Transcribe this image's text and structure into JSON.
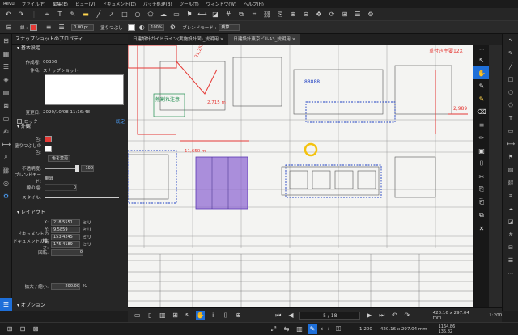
{
  "menu": {
    "items": [
      "Revu",
      "ファイル(F)",
      "編集(E)",
      "ビュー(V)",
      "ドキュメント(D)",
      "バッチ処理(B)",
      "ツール(T)",
      "ウィンドウ(W)",
      "ヘルプ(H)"
    ]
  },
  "toolbar2": {
    "fill_label": "線 :",
    "line_width": "0.00 pt",
    "opacity_label": "塗りつぶし :",
    "opacity_value": "100%",
    "blend_label": "ブレンドモード :",
    "blend_value": "乗算"
  },
  "panel": {
    "title": "スナップショットのプロパティ",
    "basic_section": "基本設定",
    "author_label": "作成者:",
    "author_value": "00336",
    "subject_label": "件名:",
    "subject_value": "スナップショット",
    "modified_label": "変更日:",
    "modified_value": "2020/10/08 11:16:48",
    "lock_label": "ロック",
    "reset_link": "既定",
    "appearance_section": "外観",
    "color_label": "色:",
    "fill_label": "塗りつぶしの色:",
    "color_change_button": "色を変更",
    "opacity_label": "不透明度:",
    "opacity_value": "100",
    "blend_label": "ブレンドモード:",
    "blend_value": "乗算",
    "line_width_label": "線の幅:",
    "line_width_value": "0",
    "style_label": "スタイル:",
    "layout_section": "レイアウト",
    "x_label": "X:",
    "x_value": "218.5551",
    "x_unit": "ミリ",
    "y_label": "Y:",
    "y_value": "9.5859",
    "y_unit": "ミリ",
    "docw_label": "ドキュメントの幅:",
    "docw_value": "153.4245",
    "docw_unit": "ミリ",
    "doch_label": "ドキュメントの高さ:",
    "doch_value": "175.4189",
    "doch_unit": "ミリ",
    "rotation_label": "回転:",
    "rotation_value": "0",
    "scale_label": "拡大 / 縮小:",
    "scale_value": "200.00",
    "scale_unit": "%",
    "options_section": "オプション"
  },
  "tabs": [
    {
      "label": "日建設計ガイドライン(実施設計図)_説明用 ×"
    },
    {
      "label": "日建設計東京ビルA3_説明用 ×"
    }
  ],
  "canvas": {
    "annotation_red_top": "重付き主要12X",
    "annotation_green": "熱割れ注意",
    "annotation_num": "88888",
    "annotation_red_right": "2,989",
    "dim_red_1": "21,256 m",
    "dim_red_2": "2,715 m",
    "dim_red_3": "11,650 m"
  },
  "bottombar": {
    "page_indicator": "5 / 18",
    "page_size": "420.16 x 297.04 mm",
    "zoom": "1:200"
  },
  "statusbar": {
    "zoom": "1:200",
    "size": "420.16 x 297.04 mm",
    "coords_x": "1164.86",
    "coords_y": "135.82"
  },
  "colors": {
    "accent_blue": "#1e6fd9",
    "annotation_red": "#e53935",
    "highlight_purple": "#8a63d2",
    "annotation_green": "#1e8c4e"
  }
}
